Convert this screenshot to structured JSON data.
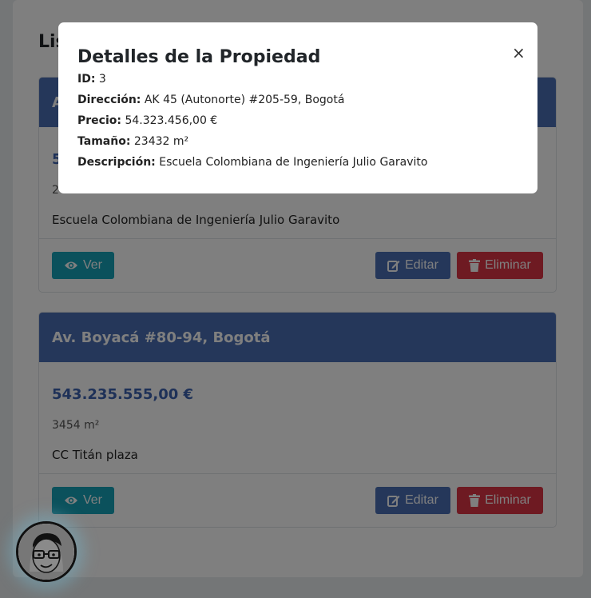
{
  "list": {
    "title": "Lis"
  },
  "properties": [
    {
      "address": "A",
      "price": "54",
      "size": "2",
      "description": "Escuela Colombiana de Ingeniería Julio Garavito"
    },
    {
      "address": "Av. Boyacá #80-94, Bogotá",
      "price": "543.235.555,00 €",
      "size": "3454 m²",
      "description": "CC Titán plaza"
    }
  ],
  "buttons": {
    "view": "Ver",
    "edit": "Editar",
    "delete": "Eliminar"
  },
  "modal": {
    "title": "Detalles de la Propiedad",
    "close": "×",
    "id_label": "ID:",
    "id_value": "3",
    "address_label": "Dirección:",
    "address_value": "AK 45 (Autonorte) #205-59, Bogotá",
    "price_label": "Precio:",
    "price_value": "54.323.456,00 €",
    "size_label": "Tamaño:",
    "size_value": "23432 m²",
    "description_label": "Descripción:",
    "description_value": "Escuela Colombiana de Ingeniería Julio Garavito"
  },
  "colors": {
    "primary": "#4a6fb5",
    "info": "#17a2b8",
    "danger": "#dc3545"
  }
}
